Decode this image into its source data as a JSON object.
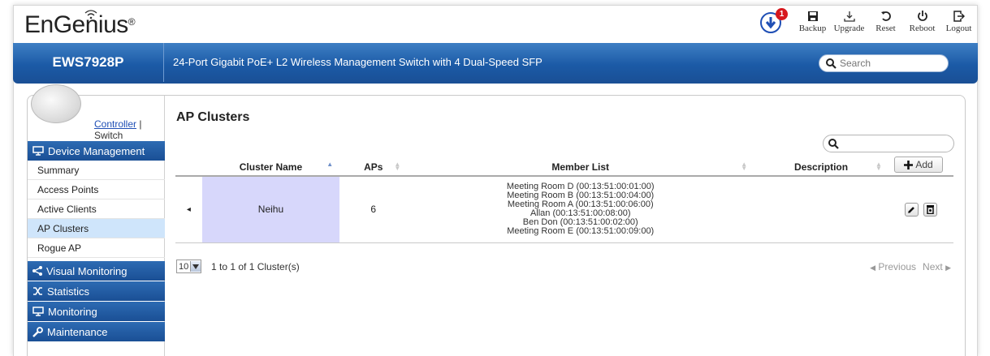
{
  "brand": {
    "logo_text": "EnGenius"
  },
  "header": {
    "notification_count": "1",
    "tools": [
      {
        "label": "Backup",
        "icon": "save-icon"
      },
      {
        "label": "Upgrade",
        "icon": "upgrade-icon"
      },
      {
        "label": "Reset",
        "icon": "reset-icon"
      },
      {
        "label": "Reboot",
        "icon": "power-icon"
      },
      {
        "label": "Logout",
        "icon": "logout-icon"
      }
    ]
  },
  "bar": {
    "model": "EWS7928P",
    "product": "24-Port Gigabit PoE+ L2 Wireless Management Switch with 4 Dual-Speed SFP",
    "search_placeholder": "Search"
  },
  "sidebar": {
    "controller_label": "Controller",
    "separator": "|",
    "switch_label": "Switch",
    "sections": {
      "device_management": "Device Management",
      "visual_monitoring": "Visual Monitoring",
      "statistics": "Statistics",
      "monitoring": "Monitoring",
      "maintenance": "Maintenance"
    },
    "items": [
      "Summary",
      "Access Points",
      "Active Clients",
      "AP Clusters",
      "Rogue AP"
    ],
    "active_item": "AP Clusters"
  },
  "main": {
    "title": "AP Clusters",
    "add_label": "Add",
    "columns": [
      "Cluster Name",
      "APs",
      "Member List",
      "Description"
    ],
    "rows": [
      {
        "expander": "◂",
        "cluster_name": "Neihu",
        "aps": "6",
        "members": [
          "Meeting Room D (00:13:51:00:01:00)",
          "Meeting Room B (00:13:51:00:04:00)",
          "Meeting Room A (00:13:51:00:06:00)",
          "Allan (00:13:51:00:08:00)",
          "Ben Don (00:13:51:00:02:00)",
          "Meeting Room E (00:13:51:00:09:00)"
        ],
        "description": ""
      }
    ],
    "page_size": "10",
    "pagination_text": "1 to 1 of 1 Cluster(s)",
    "previous_label": "Previous",
    "next_label": "Next"
  },
  "colors": {
    "brand_blue": "#1b5aa6",
    "active_row": "#cfe5fb",
    "cluster_highlight": "#d7d7fb",
    "badge_red": "#d7181e"
  }
}
